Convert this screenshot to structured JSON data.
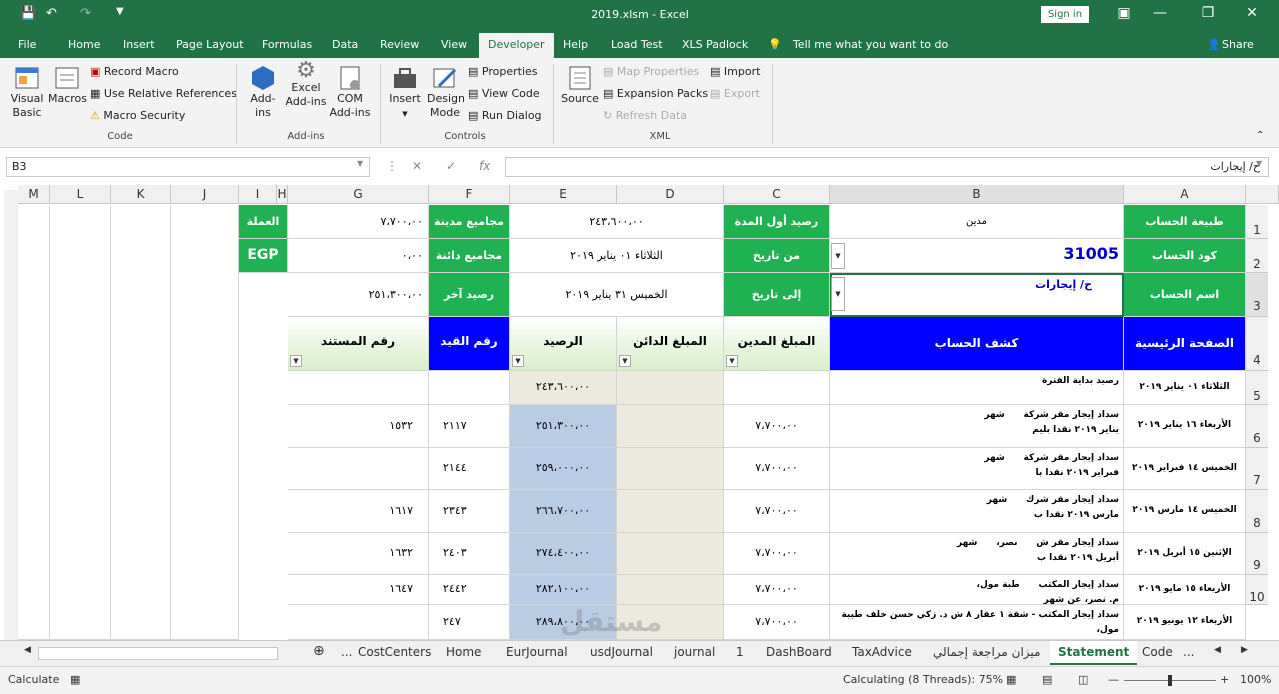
{
  "title": "2019.xlsm  -  Excel",
  "signin": "Sign in",
  "tabs": [
    "File",
    "Home",
    "Insert",
    "Page Layout",
    "Formulas",
    "Data",
    "Review",
    "View",
    "Developer",
    "Help",
    "Load Test",
    "XLS Padlock"
  ],
  "tellme": "Tell me what you want to do",
  "share": "Share",
  "ribbon": {
    "code": {
      "visual_basic": "Visual Basic",
      "macros": "Macros",
      "record": "Record Macro",
      "relative": "Use Relative References",
      "security": "Macro Security",
      "label": "Code"
    },
    "addins": {
      "addins": "Add-ins",
      "excel_addins": "Excel Add-ins",
      "com_addins": "COM Add-ins",
      "label": "Add-ins"
    },
    "controls": {
      "insert": "Insert",
      "design": "Design Mode",
      "properties": "Properties",
      "view_code": "View Code",
      "run_dialog": "Run Dialog",
      "label": "Controls"
    },
    "xml": {
      "source": "Source",
      "map_props": "Map Properties",
      "expansion": "Expansion Packs",
      "refresh": "Refresh Data",
      "import": "Import",
      "export": "Export",
      "label": "XML"
    }
  },
  "namebox": "B3",
  "formula": "ح/ إيجارات",
  "fx": "fx",
  "columns": [
    "M",
    "L",
    "K",
    "J",
    "I",
    "H",
    "G",
    "F",
    "E",
    "D",
    "C",
    "B",
    "A"
  ],
  "rows": [
    "1",
    "2",
    "3",
    "4",
    "5",
    "6",
    "7",
    "8",
    "9",
    "10"
  ],
  "cells": {
    "a1": "طبيعة الحساب",
    "b1": "مدين",
    "c1": "رصيد أول المدة",
    "e1": "٢٤٣،٦٠٠،٠٠",
    "f1": "مجاميع مدينة",
    "g1": "٧،٧٠٠،٠٠",
    "i1": "العملة",
    "a2": "كود الحساب",
    "b2": "31005",
    "c2": "من تاريخ",
    "e2": "الثلاثاء ٠١ يناير ٢٠١٩",
    "f2": "مجاميع دائنة",
    "g2": "٠،٠٠",
    "i2": "EGP",
    "a3": "اسم الحساب",
    "b3": "ح/ إيجارات",
    "c3": "إلى تاريخ",
    "e3": "الخميس ٣١ يناير ٢٠١٩",
    "f3": "رصيد آخر المدة",
    "g3": "٢٥١،٣٠٠،٠٠",
    "a4": "الصفحة الرئيسية",
    "b4": "كشف الحساب",
    "c4": "المبلغ المدين",
    "d4": "المبلغ الدائن",
    "e4": "الرصيد",
    "f4": "رقم القيد",
    "g4": "رقم المستند"
  },
  "table": [
    {
      "date": "الثلاثاء ٠١ يناير ٢٠١٩",
      "desc": "رصيد بداية الفترة",
      "debit": "",
      "balance": "٢٤٣،٦٠٠،٠٠",
      "entry": "",
      "doc": ""
    },
    {
      "date": "الأربعاء ١٦ يناير ٢٠١٩",
      "desc": "سداد إيجار مقر شركة      شهر\nيناير ٢٠١٩ نقدا بليم",
      "debit": "٧،٧٠٠،٠٠",
      "balance": "٢٥١،٣٠٠،٠٠",
      "entry": "٢١١٧",
      "doc": "١٥٣٢"
    },
    {
      "date": "الخميس ١٤ فبراير ٢٠١٩",
      "desc": "سداد إيجار مقر شركة      شهر\nفبراير ٢٠١٩ نقدا با",
      "debit": "٧،٧٠٠،٠٠",
      "balance": "٢٥٩،٠٠٠،٠٠",
      "entry": "٢١٤٤",
      "doc": ""
    },
    {
      "date": "الخميس ١٤ مارس ٢٠١٩",
      "desc": "سداد إيجار مقر شرك      شهر\nمارس ٢٠١٩ نقدا ب",
      "debit": "٧،٧٠٠،٠٠",
      "balance": "٢٦٦،٧٠٠،٠٠",
      "entry": "٢٣٤٣",
      "doc": "١٦١٧"
    },
    {
      "date": "الإثنين ١٥ أبريل ٢٠١٩",
      "desc": "سداد إيجار مقر ش      نصر،      شهر\nأبريل ٢٠١٩ نقدا ب",
      "debit": "٧،٧٠٠،٠٠",
      "balance": "٢٧٤،٤٠٠،٠٠",
      "entry": "٢٤٠٣",
      "doc": "١٦٣٢"
    },
    {
      "date": "الأربعاء ١٥ مايو ٢٠١٩",
      "desc": "سداد إيجار المكتب      طبة مول،\nم. نصر، عن شهر",
      "debit": "٧،٧٠٠،٠٠",
      "balance": "٢٨٢،١٠٠،٠٠",
      "entry": "٢٤٤٢",
      "doc": "١٦٤٧"
    },
    {
      "date": "الأربعاء ١٢ يونيو ٢٠١٩",
      "desc": "سداد إيجار المكتب - شقة ١ عقار ٨ ش د. زكي حسن خلف طيبة مول،",
      "debit": "٧،٧٠٠،٠٠",
      "balance": "٢٨٩،٨٠٠،٠٠",
      "entry": "٢٤٧",
      "doc": ""
    }
  ],
  "sheets": [
    "...",
    "CostCenters",
    "Home",
    "EurJournal",
    "usdJournal",
    "journal",
    "1",
    "DashBoard",
    "TaxAdvice",
    "ميزان مراجعة إجمالي",
    "Statement",
    "Code",
    "..."
  ],
  "status": {
    "mode": "Calculate",
    "calc": "Calculating (8 Threads): 75%",
    "zoom": "100%"
  },
  "watermark": "mostaql.com",
  "colors": {
    "excel_green": "#217346",
    "cell_green": "#1fb152",
    "header_blue": "#0000ff",
    "balance_blue": "#b8cce4"
  }
}
